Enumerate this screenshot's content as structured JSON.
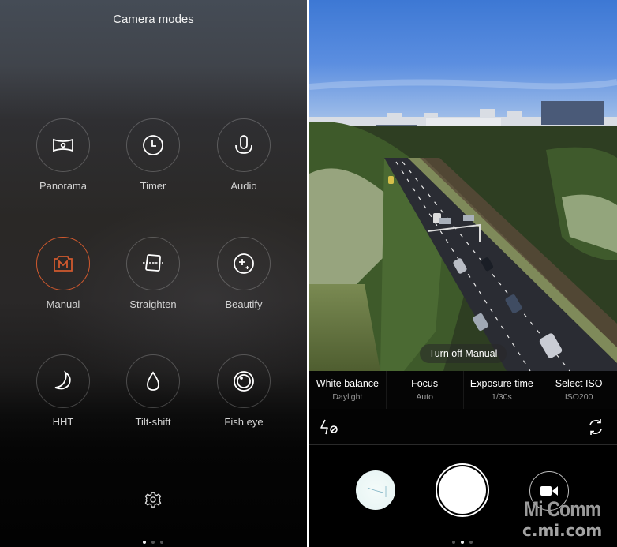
{
  "left_panel": {
    "title": "Camera modes",
    "modes": [
      {
        "label": "Panorama",
        "icon": "panorama-icon",
        "active": false
      },
      {
        "label": "Timer",
        "icon": "timer-icon",
        "active": false
      },
      {
        "label": "Audio",
        "icon": "microphone-icon",
        "active": false
      },
      {
        "label": "Manual",
        "icon": "manual-camera-icon",
        "active": true
      },
      {
        "label": "Straighten",
        "icon": "straighten-icon",
        "active": false
      },
      {
        "label": "Beautify",
        "icon": "beautify-icon",
        "active": false
      },
      {
        "label": "HHT",
        "icon": "moon-icon",
        "active": false
      },
      {
        "label": "Tilt-shift",
        "icon": "droplet-icon",
        "active": false
      },
      {
        "label": "Fish eye",
        "icon": "fisheye-icon",
        "active": false
      }
    ],
    "settings_icon": "gear-icon",
    "page_indicator": {
      "count": 3,
      "active": 1
    }
  },
  "right_panel": {
    "turn_off_label": "Turn off Manual",
    "manual_controls": [
      {
        "name": "White balance",
        "value": "Daylight"
      },
      {
        "name": "Focus",
        "value": "Auto"
      },
      {
        "name": "Exposure time",
        "value": "1/30s"
      },
      {
        "name": "Select ISO",
        "value": "ISO200"
      }
    ],
    "flash_icon": "flash-off-icon",
    "switch_camera_icon": "switch-camera-icon",
    "gallery_thumbnail_icon": "gallery-thumbnail",
    "shutter_icon": "shutter-button",
    "video_icon": "video-camera-icon",
    "page_indicator": {
      "count": 3,
      "active": 2
    }
  },
  "watermark": {
    "line1": "Mi Comm",
    "line2": "c.mi.com"
  },
  "colors": {
    "accent": "#d0592e",
    "sky": "#4f86d6"
  }
}
